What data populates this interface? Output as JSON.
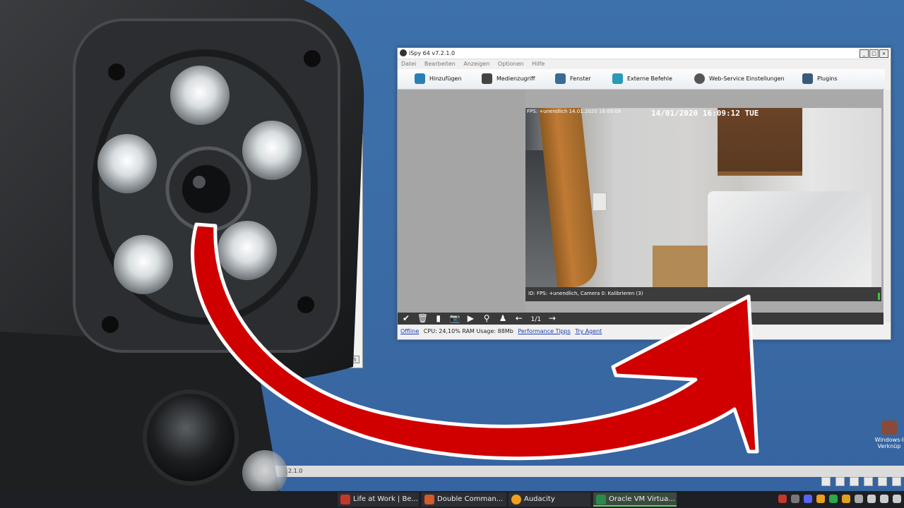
{
  "window": {
    "title": "iSpy 64 v7.2.1.0",
    "controls": [
      "_",
      "□",
      "×"
    ]
  },
  "menu": [
    "Datei",
    "Bearbeiten",
    "Anzeigen",
    "Optionen",
    "Hilfe"
  ],
  "toolbar": [
    {
      "label": "Hinzufügen",
      "icon": "add-icon",
      "color": "#2a7fb8"
    },
    {
      "label": "Medienzugriff",
      "icon": "media-icon",
      "color": "#444444"
    },
    {
      "label": "Fenster",
      "icon": "window-icon",
      "color": "#3a6a9a"
    },
    {
      "label": "Externe Befehle",
      "icon": "external-commands-icon",
      "color": "#2a9ab8"
    },
    {
      "label": "Web-Service Einstellungen",
      "icon": "web-service-icon",
      "color": "#555555"
    },
    {
      "label": "Plugins",
      "icon": "plugins-icon",
      "color": "#3a5a7a"
    }
  ],
  "camera": {
    "osd_small": "FPS: +unendlich 14.01.2020 16:09:08",
    "osd_timestamp": "14/01/2020 16:09:12 TUE",
    "status": "ID: FPS: +unendlich, Camera 0: Kalibrieren (3)"
  },
  "cam_tools": {
    "icons": [
      "check-icon",
      "trash-icon",
      "save-icon",
      "camera-icon",
      "youtube-icon",
      "search-icon",
      "user-icon",
      "arrow-left-icon"
    ],
    "glyphs": [
      "✔",
      "🗑",
      "▮",
      "📷",
      "▶",
      "⚲",
      "♟",
      "←"
    ],
    "pager": "1/1",
    "next": "→"
  },
  "statusbar": {
    "offline": "Offline",
    "cpu": "CPU: 24,10% RAM Usage: 88Mb",
    "performance": "Performance Tipps",
    "agent": "Try Agent"
  },
  "background": {
    "button_fragment": "nnen",
    "version_fragment": "2.1.0"
  },
  "desktop_icon": {
    "label": "Windows-I Verknüp"
  },
  "taskbar": {
    "tasks": [
      {
        "label": "Life at Work | Be...",
        "color": "#c0392b"
      },
      {
        "label": "Double Comman...",
        "color": "#d35a2a"
      },
      {
        "label": "Audacity",
        "color": "#f0a020"
      },
      {
        "label": "Oracle VM Virtua...",
        "color": "#2a8a4a",
        "active": true
      }
    ]
  },
  "colors": {
    "arrow": "#d00000",
    "desktop": "#3a6ea8"
  }
}
